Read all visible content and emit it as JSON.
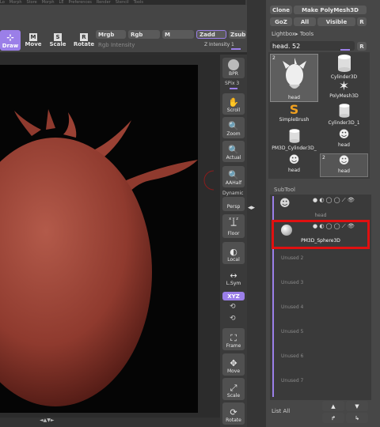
{
  "top_strip": {
    "labels": [
      "Lo",
      "Morph",
      "Store",
      "Morph",
      "LE",
      "Preferences",
      "Render",
      "Stencil",
      "Tools"
    ]
  },
  "toolbar": {
    "draw": "Draw",
    "move": "Move",
    "scale": "Scale",
    "rotate": "Rotate",
    "mrgb": "Mrgb",
    "rgb": "Rgb",
    "m": "M",
    "zadd": "Zadd",
    "zsub": "Zsub",
    "rgb_intensity": "Rgb Intensity",
    "z_intensity": "Z Intensity 1"
  },
  "right_shelf": {
    "bpr": "BPR",
    "spix": "SPix 3",
    "scroll": "Scroll",
    "zoom": "Zoom",
    "actual": "Actual",
    "aahalf": "AAHalf",
    "dynamic": "Dynamic",
    "persp": "Persp",
    "floor": "Floor",
    "local": "Local",
    "lsym": "L.Sym",
    "xyz": "XYZ",
    "frame": "Frame",
    "move": "Move",
    "scale": "Scale",
    "rotate": "Rotate"
  },
  "tool_panel": {
    "clone": "Clone",
    "make_polymesh": "Make PolyMesh3D",
    "goz": "GoZ",
    "all": "All",
    "visible": "Visible",
    "r": "R",
    "lightbox_tools": "Lightbox▸ Tools",
    "current_tool": "head. 52",
    "r2": "R",
    "tools": [
      {
        "name": "head",
        "count": "2"
      },
      {
        "name": "Cylinder3D",
        "count": ""
      },
      {
        "name": "PolyMesh3D",
        "count": ""
      },
      {
        "name": "SimpleBrush",
        "count": ""
      },
      {
        "name": "Cylinder3D_1",
        "count": ""
      },
      {
        "name": "PM3D_Cylinder3D_",
        "count": ""
      },
      {
        "name": "head",
        "count": ""
      },
      {
        "name": "head",
        "count": ""
      },
      {
        "name": "head",
        "count": "2"
      }
    ]
  },
  "subtool": {
    "title": "SubTool",
    "items": [
      {
        "name": "head"
      },
      {
        "name": "PM3D_Sphere3D"
      }
    ],
    "unused": [
      "Unused 2",
      "Unused 3",
      "Unused 4",
      "Unused 5",
      "Unused 6",
      "Unused 7"
    ],
    "list_all": "List All"
  },
  "colors": {
    "accent": "#9b7fe8",
    "highlight": "#e01010",
    "model": "#8f3a2e"
  }
}
